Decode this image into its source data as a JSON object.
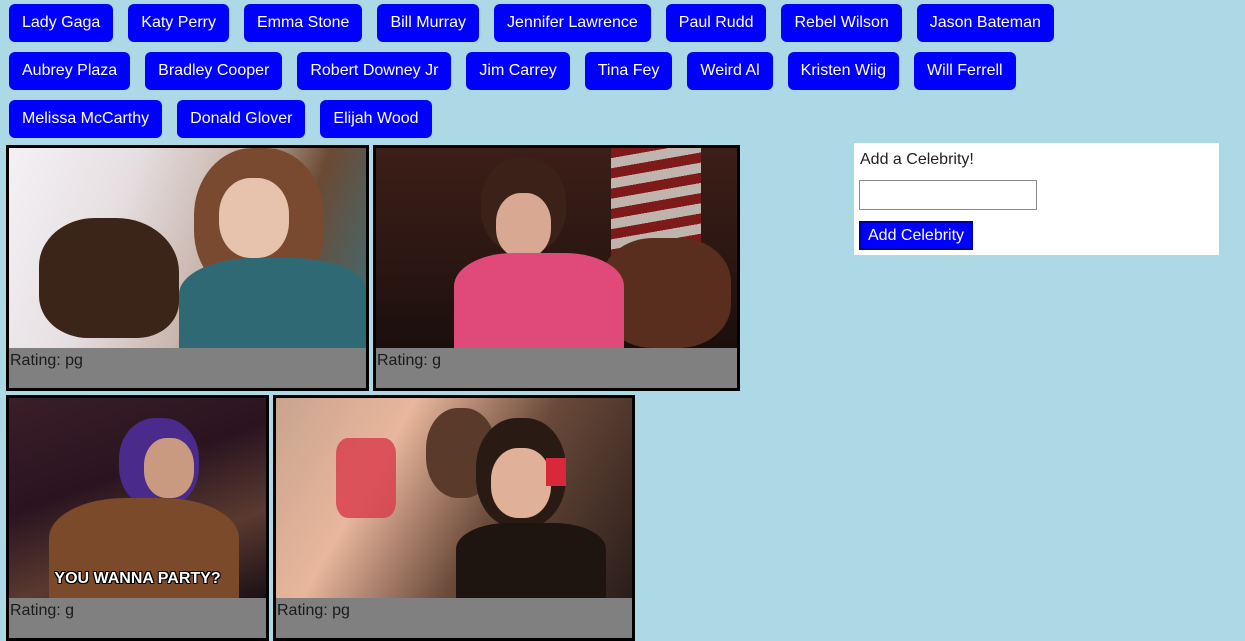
{
  "celebrity_buttons": [
    "Lady Gaga",
    "Katy Perry",
    "Emma Stone",
    "Bill Murray",
    "Jennifer Lawrence",
    "Paul Rudd",
    "Rebel Wilson",
    "Jason Bateman",
    "Aubrey Plaza",
    "Bradley Cooper",
    "Robert Downey Jr",
    "Jim Carrey",
    "Tina Fey",
    "Weird Al",
    "Kristen Wiig",
    "Will Ferrell",
    "Melissa McCarthy",
    "Donald Glover",
    "Elijah Wood"
  ],
  "gifs": [
    {
      "rating": "Rating: pg",
      "caption": ""
    },
    {
      "rating": "Rating: g",
      "caption": ""
    },
    {
      "rating": "Rating: g",
      "caption": "YOU WANNA PARTY?"
    },
    {
      "rating": "Rating: pg",
      "caption": ""
    }
  ],
  "form": {
    "label": "Add a Celebrity!",
    "input_value": "",
    "button_label": "Add Celebrity"
  },
  "colors": {
    "page_background": "#add8e6",
    "button_background": "#0000ff",
    "card_background": "#808080"
  }
}
